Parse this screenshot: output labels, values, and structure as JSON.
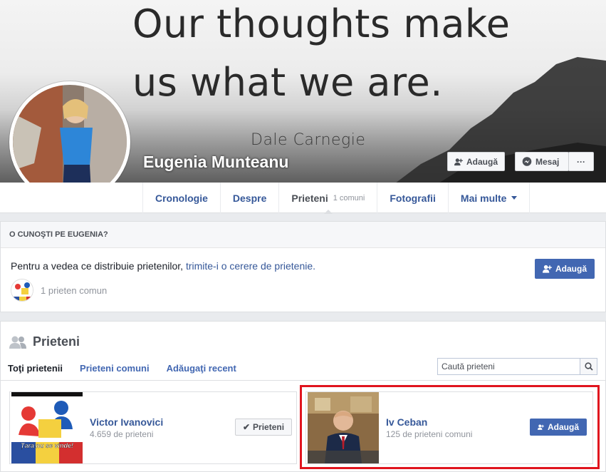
{
  "cover": {
    "quote_line1": "Our thoughts make",
    "quote_line2": "us what we are.",
    "author": "Dale Carnegie",
    "profile_name": "Eugenia Munteanu",
    "add_button": "Adaugă",
    "message_button": "Mesaj",
    "more_button": "···"
  },
  "nav": {
    "tabs": [
      {
        "label": "Cronologie",
        "sub": ""
      },
      {
        "label": "Despre",
        "sub": ""
      },
      {
        "label": "Prieteni",
        "sub": "1 comuni"
      },
      {
        "label": "Fotografii",
        "sub": ""
      },
      {
        "label": "Mai multe",
        "sub": ""
      }
    ]
  },
  "know": {
    "heading": "O CUNOŞTI PE EUGENIA?",
    "text": "Pentru a vedea ce distribuie prietenilor, ",
    "link": "trimite-i o cerere de prietenie.",
    "add_button": "Adaugă",
    "mutual": "1 prieten comun"
  },
  "friends": {
    "title": "Prieteni",
    "tabs": [
      "Toţi prietenii",
      "Prieteni comuni",
      "Adăugaţi recent"
    ],
    "search_placeholder": "Caută prieteni",
    "cards": [
      {
        "name": "Victor Ivanovici",
        "meta": "4.659 de prieteni",
        "button": "Prieteni",
        "image_caption": "Țara nu se vinde!"
      },
      {
        "name": "Iv Ceban",
        "meta": "125 de prieteni comuni",
        "button": "Adaugă"
      }
    ]
  },
  "colors": {
    "brand": "#4267b2",
    "link": "#365899",
    "highlight": "#e0141e"
  }
}
